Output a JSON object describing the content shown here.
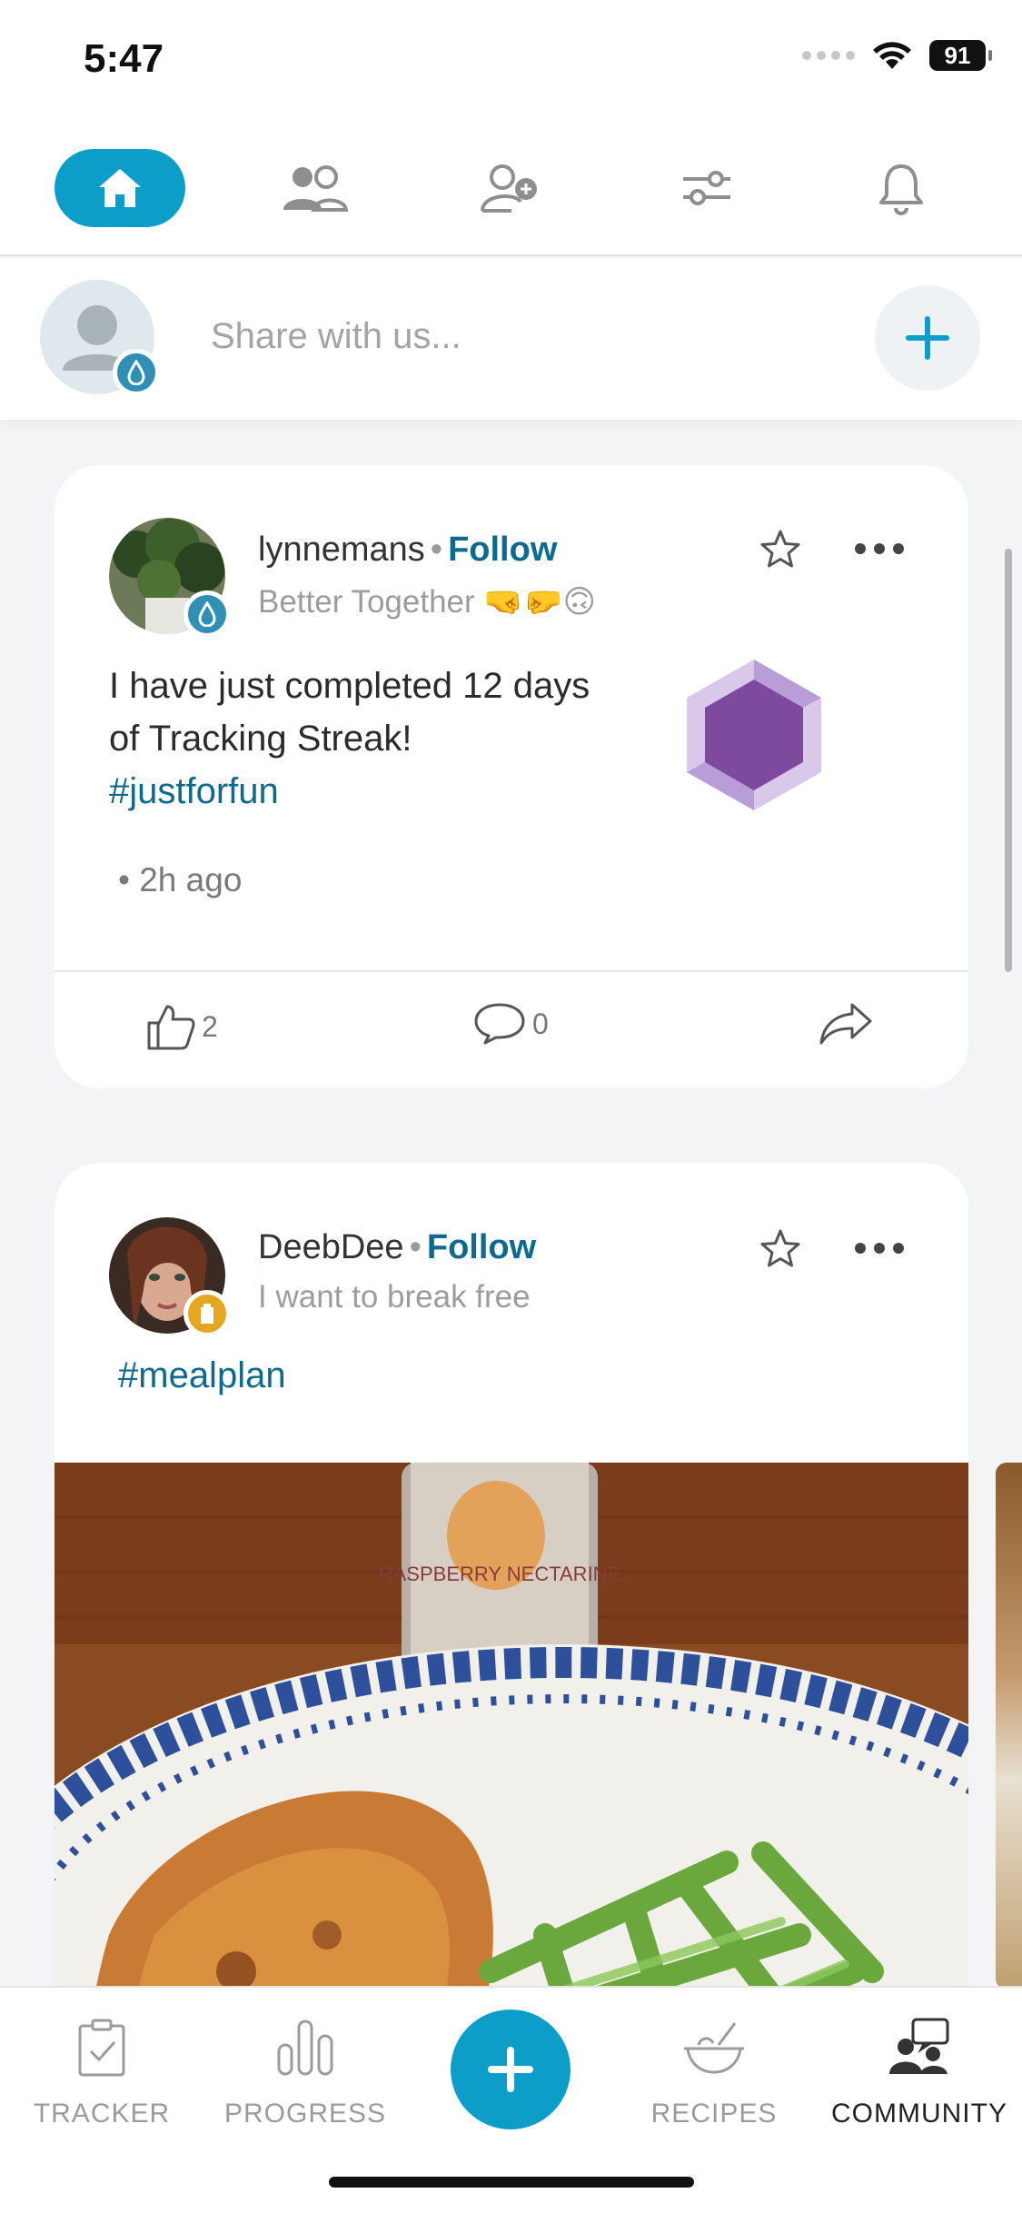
{
  "status_bar": {
    "time": "5:47",
    "battery": "91"
  },
  "share": {
    "placeholder": "Share with us..."
  },
  "posts": [
    {
      "username": "lynnemans",
      "follow_label": "Follow",
      "subtitle": "Better Together 🤜🤛🙃",
      "text": "I have just completed 12 days of Tracking Streak!",
      "hashtag": "#justforfun",
      "time_ago": "2h ago",
      "likes": "2",
      "comments": "0"
    },
    {
      "username": "DeebDee",
      "follow_label": "Follow",
      "subtitle": "I want to break free",
      "hashtag": "#mealplan",
      "photo_can_text": "RASPBERRY NECTARINE"
    }
  ],
  "bottom_nav": {
    "tracker": "TRACKER",
    "progress": "PROGRESS",
    "recipes": "RECIPES",
    "community": "COMMUNITY"
  },
  "colors": {
    "accent": "#0c9ec9",
    "link": "#0d6a8c",
    "badge_purple": "#7e4a9e"
  }
}
